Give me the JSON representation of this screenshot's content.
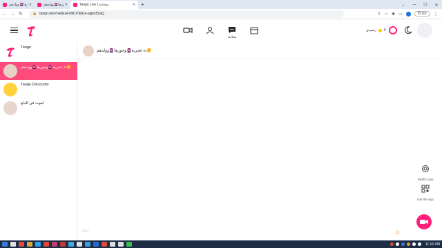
{
  "browser": {
    "tabs": [
      {
        "title": "ء عجرية🧕وجورها🧕وولدهم",
        "favicon": "tango-icon"
      },
      {
        "title": "ـء عجرية🧕وجورها🧕وولدهم",
        "favicon": "tango-icon"
      },
      {
        "title": "Tango Live | محادثة",
        "favicon": "tango-icon"
      }
    ],
    "new_tab_label": "+",
    "url": "tango.me/chat/EaFo8lCi7IidUa-wgox52aQ",
    "error_label": "Error"
  },
  "header": {
    "chats_label": "محادثة",
    "coins_label": "رصيدي",
    "coin_count": "0"
  },
  "sidebar": {
    "conversations": [
      {
        "name": "Tango"
      },
      {
        "name": "ـء عجرية🧕وجورها🧕وولدهم🌼"
      },
      {
        "name": "Tango Discounts"
      },
      {
        "name": "اموت في الدلع"
      }
    ]
  },
  "chat": {
    "title": "ـء عجرية🧕وجورها🧕وولدهم🌼",
    "input_hint": "رسالة"
  },
  "actions": {
    "refill_label": "Refill Coins",
    "get_app_label": "Get the App"
  },
  "taskbar": {
    "time": "11:16 PM"
  },
  "colors": {
    "brand": "#ff1f7a",
    "selected_row": "#ff4a7c",
    "taskbar": "#1e2d46"
  }
}
